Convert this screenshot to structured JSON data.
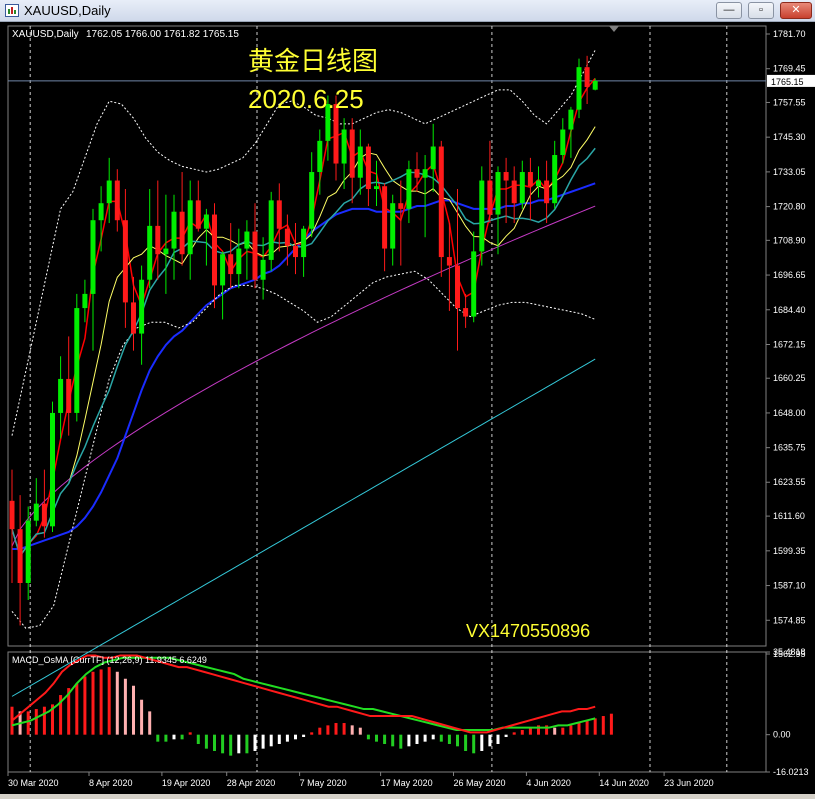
{
  "window": {
    "title": "XAUUSD,Daily",
    "minimize": "—",
    "restore": "▫",
    "close": "✕"
  },
  "chart_header": {
    "symbol_info": "XAUUSD,Daily",
    "ohlc": "1762.05 1766.00 1761.82 1765.15"
  },
  "overlay": {
    "title_cn": "黄金日线图",
    "date": "2020.6.25",
    "contact": "VX1470550896"
  },
  "colors": {
    "bull": "#00ee00",
    "bear": "#ff1a1a",
    "ma_fast": "#ff0000",
    "ma_yellow": "#ffff66",
    "ma_teal": "#2aa6a6",
    "ma_blue": "#1a2cff",
    "ma_magenta": "#c43ac4",
    "ma_cyan": "#34c8d8",
    "bollinger": "#ffffff",
    "price_line": "#6f86a8",
    "macd_line": "#ff1a1a",
    "signal_line": "#22dd22"
  },
  "chart_data": [
    {
      "type": "candlestick",
      "title": "XAUUSD,Daily",
      "current_price_label": "1765.15",
      "y_ticks": [
        "1781.70",
        "1769.45",
        "1757.55",
        "1745.30",
        "1733.05",
        "1720.80",
        "1708.90",
        "1696.65",
        "1684.40",
        "1672.15",
        "1660.25",
        "1648.00",
        "1635.75",
        "1623.55",
        "1611.60",
        "1599.35",
        "1587.10",
        "1574.85",
        "1562.95"
      ],
      "ylim": [
        1562.95,
        1781.7
      ],
      "x_labels": [
        "30 Mar 2020",
        "8 Apr 2020",
        "19 Apr 2020",
        "28 Apr 2020",
        "7 May 2020",
        "17 May 2020",
        "26 May 2020",
        "4 Jun 2020",
        "14 Jun 2020",
        "23 Jun 2020"
      ],
      "x_label_index": [
        0,
        10,
        19,
        27,
        36,
        46,
        55,
        64,
        73,
        81
      ],
      "vertical_separators_index": [
        2,
        30,
        59,
        88
      ],
      "ohlc": [
        [
          1617,
          1628,
          1588,
          1607
        ],
        [
          1607,
          1619,
          1573,
          1588
        ],
        [
          1588,
          1615,
          1582,
          1610
        ],
        [
          1610,
          1625,
          1608,
          1616
        ],
        [
          1616,
          1628,
          1604,
          1608
        ],
        [
          1608,
          1652,
          1606,
          1648
        ],
        [
          1648,
          1668,
          1639,
          1660
        ],
        [
          1660,
          1675,
          1640,
          1648
        ],
        [
          1648,
          1690,
          1645,
          1685
        ],
        [
          1685,
          1695,
          1680,
          1690
        ],
        [
          1690,
          1720,
          1670,
          1716
        ],
        [
          1716,
          1728,
          1705,
          1722
        ],
        [
          1722,
          1738,
          1715,
          1730
        ],
        [
          1730,
          1734,
          1712,
          1716
        ],
        [
          1716,
          1727,
          1678,
          1687
        ],
        [
          1687,
          1696,
          1670,
          1676
        ],
        [
          1676,
          1700,
          1665,
          1695
        ],
        [
          1695,
          1727,
          1692,
          1714
        ],
        [
          1714,
          1730,
          1695,
          1704
        ],
        [
          1704,
          1725,
          1690,
          1706
        ],
        [
          1706,
          1725,
          1695,
          1719
        ],
        [
          1719,
          1733,
          1700,
          1704
        ],
        [
          1704,
          1730,
          1695,
          1723
        ],
        [
          1723,
          1730,
          1712,
          1713
        ],
        [
          1713,
          1720,
          1700,
          1718
        ],
        [
          1718,
          1722,
          1685,
          1693
        ],
        [
          1693,
          1705,
          1681,
          1704
        ],
        [
          1704,
          1715,
          1692,
          1697
        ],
        [
          1697,
          1713,
          1692,
          1706
        ],
        [
          1706,
          1716,
          1695,
          1712
        ],
        [
          1712,
          1722,
          1692,
          1695
        ],
        [
          1695,
          1710,
          1688,
          1702
        ],
        [
          1702,
          1726,
          1698,
          1723
        ],
        [
          1723,
          1729,
          1705,
          1713
        ],
        [
          1713,
          1718,
          1700,
          1707
        ],
        [
          1707,
          1715,
          1697,
          1703
        ],
        [
          1703,
          1714,
          1696,
          1713
        ],
        [
          1713,
          1740,
          1710,
          1733
        ],
        [
          1733,
          1748,
          1725,
          1744
        ],
        [
          1744,
          1760,
          1737,
          1757
        ],
        [
          1757,
          1760,
          1730,
          1736
        ],
        [
          1736,
          1752,
          1727,
          1748
        ],
        [
          1748,
          1752,
          1722,
          1731
        ],
        [
          1731,
          1748,
          1725,
          1742
        ],
        [
          1742,
          1743,
          1721,
          1727
        ],
        [
          1727,
          1737,
          1721,
          1728
        ],
        [
          1728,
          1729,
          1698,
          1706
        ],
        [
          1706,
          1725,
          1700,
          1722
        ],
        [
          1722,
          1730,
          1700,
          1720
        ],
        [
          1720,
          1737,
          1715,
          1734
        ],
        [
          1734,
          1740,
          1726,
          1731
        ],
        [
          1731,
          1739,
          1710,
          1734
        ],
        [
          1734,
          1750,
          1726,
          1742
        ],
        [
          1742,
          1744,
          1696,
          1703
        ],
        [
          1703,
          1715,
          1684,
          1700
        ],
        [
          1700,
          1727,
          1670,
          1685
        ],
        [
          1685,
          1690,
          1678,
          1682
        ],
        [
          1682,
          1712,
          1680,
          1705
        ],
        [
          1705,
          1735,
          1700,
          1730
        ],
        [
          1730,
          1744,
          1715,
          1718
        ],
        [
          1718,
          1735,
          1704,
          1733
        ],
        [
          1733,
          1738,
          1715,
          1730
        ],
        [
          1730,
          1735,
          1715,
          1722
        ],
        [
          1722,
          1737,
          1720,
          1733
        ],
        [
          1733,
          1738,
          1716,
          1728
        ],
        [
          1728,
          1735,
          1724,
          1730
        ],
        [
          1730,
          1737,
          1715,
          1722
        ],
        [
          1722,
          1744,
          1720,
          1739
        ],
        [
          1739,
          1752,
          1736,
          1748
        ],
        [
          1748,
          1756,
          1738,
          1755
        ],
        [
          1755,
          1773,
          1752,
          1770
        ],
        [
          1770,
          1774,
          1757,
          1763
        ],
        [
          1762.05,
          1766.0,
          1761.82,
          1765.15
        ]
      ],
      "bollinger_upper": [
        1640,
        1660,
        1680,
        1700,
        1720,
        1726,
        1738,
        1750,
        1758,
        1757,
        1752,
        1745,
        1740,
        1737,
        1735,
        1734,
        1733,
        1734,
        1736,
        1738,
        1743,
        1750,
        1757,
        1758,
        1756,
        1753,
        1752,
        1750,
        1750,
        1752,
        1754,
        1755,
        1754,
        1752,
        1750,
        1752,
        1754,
        1756,
        1758,
        1760,
        1762,
        1762,
        1758,
        1753,
        1750,
        1755,
        1760,
        1768,
        1776
      ],
      "bollinger_lower": [
        1578,
        1572,
        1573,
        1580,
        1600,
        1620,
        1640,
        1660,
        1672,
        1678,
        1680,
        1680,
        1678,
        1680,
        1685,
        1690,
        1693,
        1693,
        1692,
        1690,
        1687,
        1684,
        1680,
        1682,
        1686,
        1690,
        1694,
        1696,
        1697,
        1698,
        1695,
        1690,
        1685,
        1682,
        1684,
        1686,
        1687,
        1687,
        1686,
        1685,
        1684,
        1683,
        1681
      ],
      "ma_blue": [
        1600,
        1600,
        1601,
        1602,
        1603,
        1604,
        1605,
        1606,
        1608,
        1611,
        1615,
        1620,
        1626,
        1632,
        1640,
        1648,
        1656,
        1663,
        1668,
        1672,
        1675,
        1677,
        1680,
        1683,
        1686,
        1688,
        1690,
        1692,
        1693,
        1694,
        1695,
        1697,
        1698,
        1700,
        1703,
        1706,
        1709,
        1712,
        1714,
        1716,
        1718,
        1719,
        1720,
        1720,
        1720,
        1719,
        1719,
        1719,
        1719,
        1720,
        1721,
        1721,
        1722,
        1723,
        1723,
        1722,
        1721,
        1720,
        1720,
        1720,
        1720,
        1721,
        1721,
        1722,
        1722,
        1723,
        1723,
        1724,
        1725,
        1726,
        1727,
        1728,
        1729
      ],
      "ma_magenta_start": 1601,
      "ma_magenta_end": 1721,
      "ma_cyan_start": 1548,
      "ma_cyan_end": 1667
    },
    {
      "type": "bar",
      "title": "MACD_OsMA [CurrTF] (12,26,9) 11.9345 6.6249",
      "y_ticks": [
        "35.4818",
        "0.00",
        "-16.0213"
      ],
      "ylim": [
        -16.0213,
        35.4818
      ],
      "macd": [
        6,
        9,
        12,
        15,
        18,
        22,
        27,
        30,
        32,
        34,
        34,
        33,
        33,
        34,
        34,
        34,
        33,
        32,
        31,
        30,
        29,
        29,
        28,
        27,
        26,
        25,
        24,
        23,
        22,
        21,
        20,
        19,
        18,
        17,
        16,
        15,
        14,
        13,
        12,
        12,
        11,
        10,
        9,
        8,
        8,
        8,
        8,
        8,
        8,
        7,
        6,
        5,
        4,
        3,
        2,
        1,
        1,
        1,
        2,
        3,
        4,
        5,
        6,
        7,
        8,
        9,
        10,
        10,
        11,
        11,
        12
      ],
      "signal": [
        4,
        5,
        6,
        8,
        10,
        13,
        17,
        22,
        26,
        29,
        31,
        32,
        33,
        33,
        33,
        33,
        33,
        33,
        32,
        31,
        30,
        29,
        28,
        27,
        26,
        24,
        23,
        22,
        21,
        20,
        19,
        18,
        17,
        16,
        15,
        14,
        13,
        12,
        11,
        11,
        10,
        9,
        8,
        7,
        6,
        5,
        4,
        3,
        2,
        2,
        2,
        2,
        2,
        3,
        3,
        3,
        3,
        3,
        3,
        4,
        4,
        5,
        6,
        7
      ],
      "histogram": [
        12,
        10,
        10,
        11,
        12,
        13,
        17,
        20,
        22,
        25,
        27,
        28,
        29,
        27,
        24,
        21,
        15,
        10,
        -3,
        -3,
        -2,
        -2,
        1,
        -4,
        -6,
        -7,
        -8,
        -9,
        -8,
        -8,
        -7,
        -6,
        -5,
        -4,
        -3,
        -2,
        -1,
        1,
        3,
        4,
        5,
        5,
        4,
        3,
        -2,
        -3,
        -4,
        -5,
        -6,
        -5,
        -4,
        -3,
        -2,
        -3,
        -4,
        -5,
        -7,
        -8,
        -7,
        -5,
        -4,
        -1,
        1,
        2,
        3,
        4,
        4,
        3,
        3,
        4,
        5,
        6,
        7,
        8,
        9
      ]
    }
  ]
}
